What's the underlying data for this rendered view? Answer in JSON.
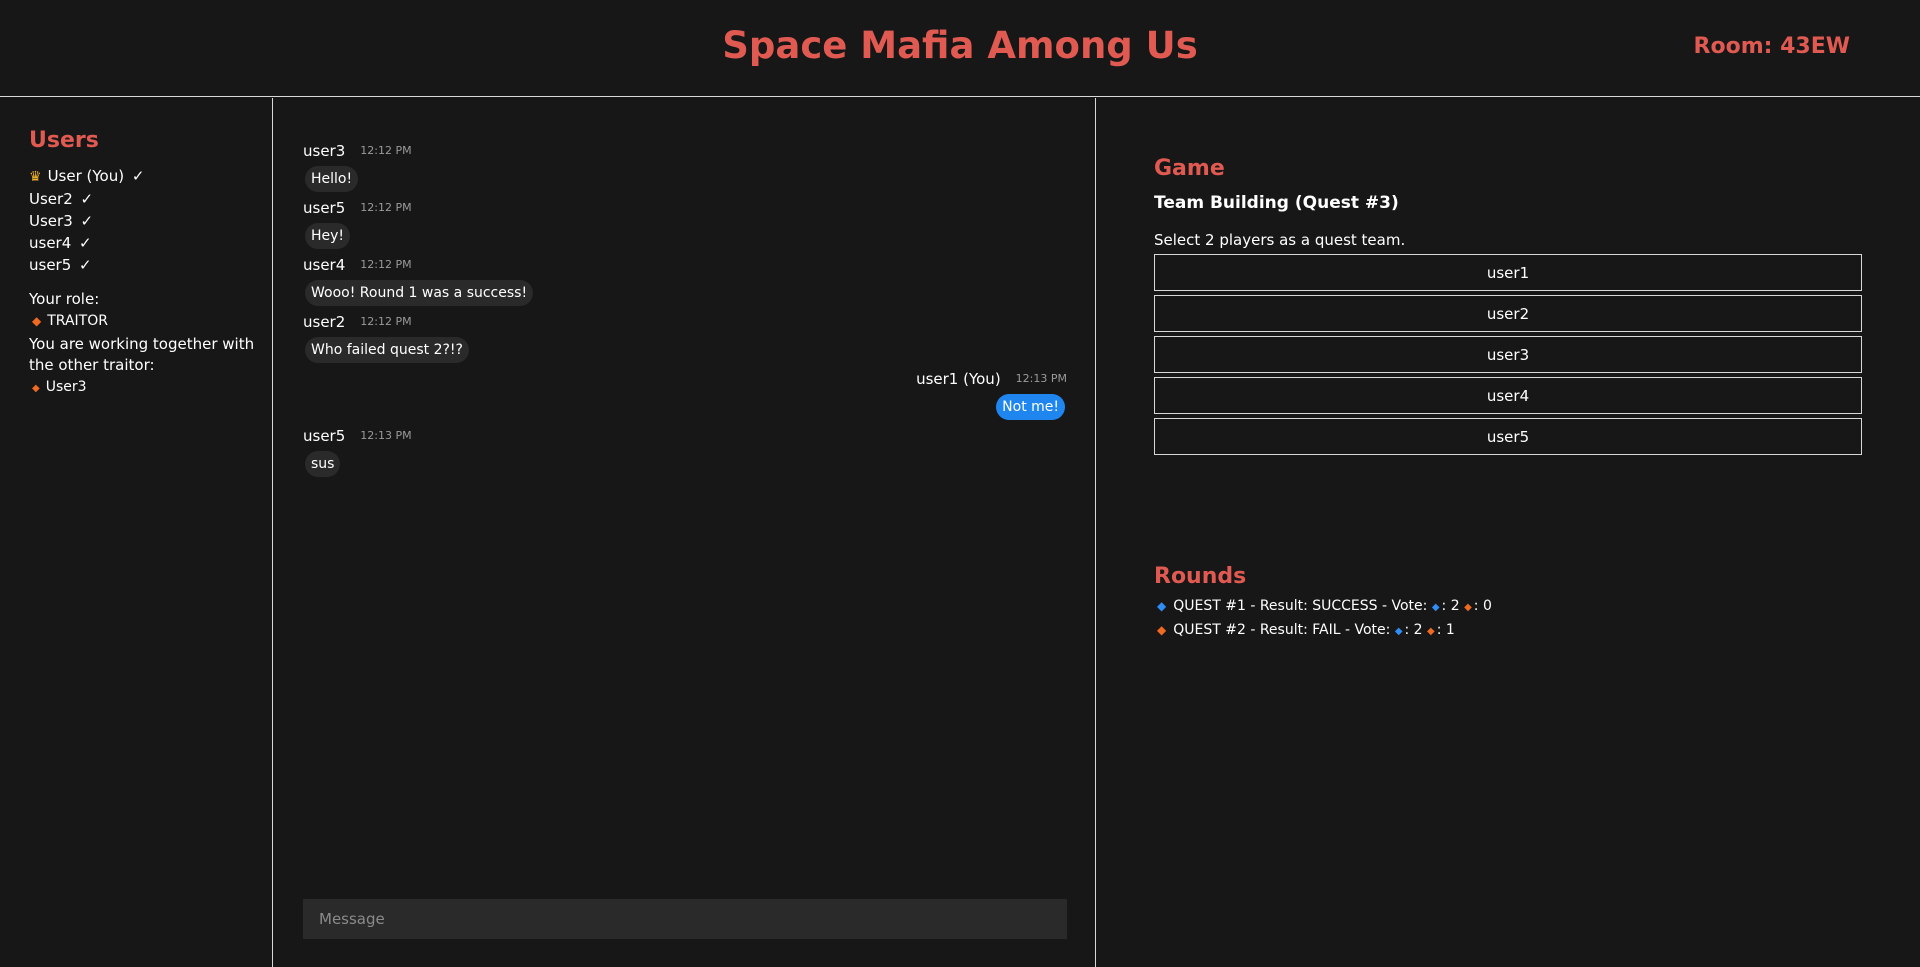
{
  "header": {
    "title": "Space Mafia Among Us",
    "room": "Room: 43EW"
  },
  "sidebar": {
    "heading": "Users",
    "users": [
      {
        "name": "User (You)",
        "crown": true
      },
      {
        "name": "User2",
        "crown": false
      },
      {
        "name": "User3",
        "crown": false
      },
      {
        "name": "user4",
        "crown": false
      },
      {
        "name": "user5",
        "crown": false
      }
    ],
    "check": "✓",
    "role_label": "Your role:",
    "role": "TRAITOR",
    "role_note": "You are working together with the other traitor:",
    "ally": "User3"
  },
  "chat": {
    "messages": [
      {
        "user": "user3",
        "time": "12:12 PM",
        "text": "Hello!",
        "own": false
      },
      {
        "user": "user5",
        "time": "12:12 PM",
        "text": "Hey!",
        "own": false
      },
      {
        "user": "user4",
        "time": "12:12 PM",
        "text": "Wooo! Round 1 was a success!",
        "own": false
      },
      {
        "user": "user2",
        "time": "12:12 PM",
        "text": "Who failed quest 2?!?",
        "own": false
      },
      {
        "user": "user1 (You)",
        "time": "12:13 PM",
        "text": "Not me!",
        "own": true
      },
      {
        "user": "user5",
        "time": "12:13 PM",
        "text": "sus",
        "own": false
      }
    ],
    "input_placeholder": "Message"
  },
  "game": {
    "heading": "Game",
    "phase": "Team Building (Quest #3)",
    "instruction": "Select 2 players as a quest team.",
    "players": [
      "user1",
      "user2",
      "user3",
      "user4",
      "user5"
    ]
  },
  "rounds": {
    "heading": "Rounds",
    "items": [
      {
        "text": "QUEST #1 - Result: SUCCESS - Vote:",
        "result": "success",
        "success_votes": ": 2",
        "fail_votes": ": 0"
      },
      {
        "text": "QUEST #2 - Result: FAIL - Vote:",
        "result": "fail",
        "success_votes": ": 2",
        "fail_votes": ": 1"
      }
    ]
  },
  "colors": {
    "accent": "#e05a52",
    "own_bubble": "#1f86f0",
    "success_diamond": "#2f8df5",
    "fail_diamond": "#f06a22",
    "crown": "#f2b02c"
  },
  "icons": {
    "crown": "crown-icon",
    "check": "check-icon",
    "success": "blue-diamond-icon",
    "fail": "orange-diamond-icon"
  }
}
